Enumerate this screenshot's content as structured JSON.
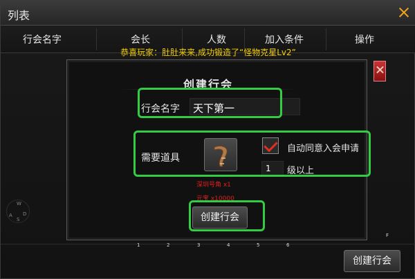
{
  "window": {
    "title": "列表"
  },
  "table": {
    "columns": [
      "行会名字",
      "会长",
      "人数",
      "加入条件",
      "操作"
    ]
  },
  "broadcast": "恭喜玩家：肚肚来来,成功锻造了“怪物克星Lv2”",
  "joystick": {
    "w": "W",
    "a": "A",
    "s": "S",
    "d": "D"
  },
  "dialog": {
    "title": "创建行会",
    "name_label": "行会名字",
    "name_value": "天下第一",
    "item_label": "需要道具",
    "item_icon": "horn-icon",
    "item_name": "深圳号角 x1",
    "gold_cost": "元宝 x10000",
    "auto_accept_label": "自动同意入会申请",
    "auto_accept_checked": true,
    "level_value": "1",
    "level_suffix": "级以上",
    "create_button": "创建行会"
  },
  "hotbar": [
    "1",
    "2",
    "3",
    "4",
    "5",
    "6"
  ],
  "corner_key": "F",
  "footer_button": "创建行会",
  "colors": {
    "highlight": "#33cc44",
    "broadcast": "#f5d000",
    "close": "#f0a020",
    "warning": "#e02020"
  }
}
